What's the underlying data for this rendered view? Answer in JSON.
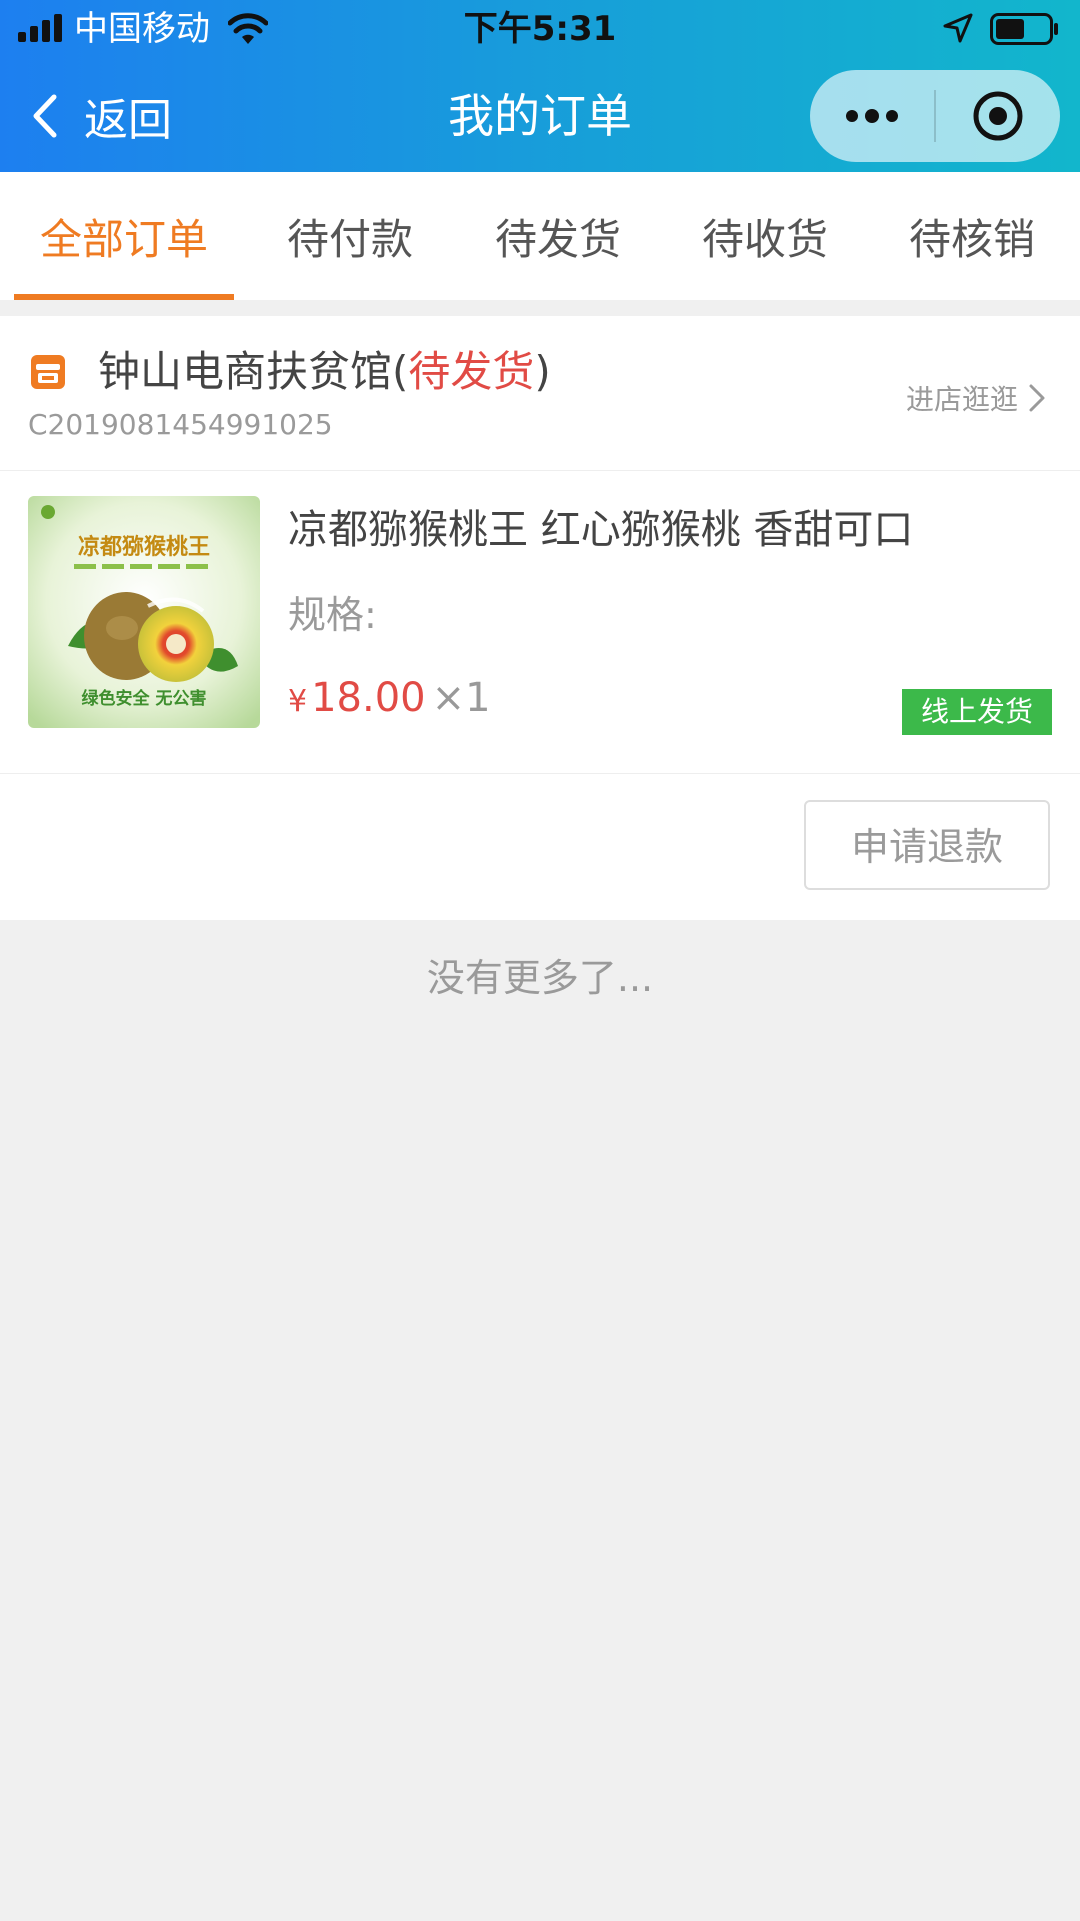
{
  "status_bar": {
    "carrier": "中国移动",
    "time": "下午5:31"
  },
  "navbar": {
    "back_label": "返回",
    "title": "我的订单"
  },
  "tabs": [
    {
      "label": "全部订单",
      "active": true
    },
    {
      "label": "待付款",
      "active": false
    },
    {
      "label": "待发货",
      "active": false
    },
    {
      "label": "待收货",
      "active": false
    },
    {
      "label": "待核销",
      "active": false
    }
  ],
  "order": {
    "store_name": "钟山电商扶贫馆",
    "status_open": "(",
    "status": "待发货",
    "status_close": ")",
    "order_number": "C2019081454991025",
    "visit_store_label": "进店逛逛",
    "product": {
      "title": "凉都猕猴桃王 红心猕猴桃 香甜可口",
      "spec_label": "规格:",
      "currency": "¥",
      "price": "18.00",
      "quantity": "×1",
      "image_text_top": "凉都猕猴桃王",
      "image_text_bottom": "绿色安全 无公害",
      "ship_badge": "线上发货"
    },
    "refund_button": "申请退款"
  },
  "footer": {
    "no_more": "没有更多了..."
  },
  "colors": {
    "accent_orange": "#ef7b22",
    "status_red": "#e14b45",
    "badge_green": "#3cb94a",
    "header_gradient_start": "#1d7ff0",
    "header_gradient_end": "#12b6cc"
  }
}
